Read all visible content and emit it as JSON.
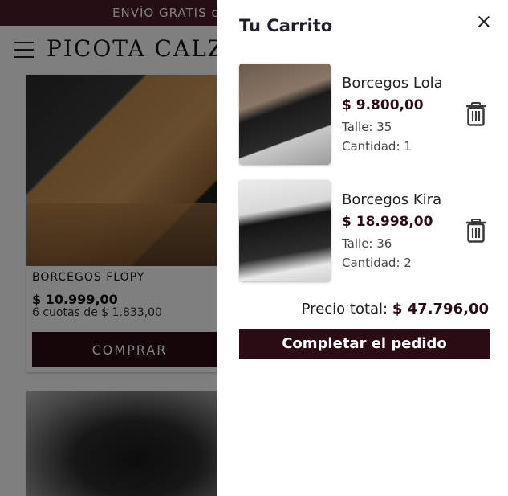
{
  "promo": {
    "text": "ENVÍO GRATIS c"
  },
  "header": {
    "logo": "PICOTA CALZ"
  },
  "product": {
    "name": "BORCEGOS FLOPY",
    "price": "$ 10.999,00",
    "installments": "6 cuotas de $ 1.833,00",
    "buy_label": "COMPRAR"
  },
  "cart": {
    "title": "Tu Carrito",
    "items": [
      {
        "name": "Borcegos Lola",
        "price": "$ 9.800,00",
        "size": "Talle: 35",
        "qty": "Cantidad: 1"
      },
      {
        "name": "Borcegos Kira",
        "price": "$ 18.998,00",
        "size": "Talle: 36",
        "qty": "Cantidad: 2"
      }
    ],
    "total_label": "Precio total:",
    "total_value": "$ 47.796,00",
    "checkout_label": "Completar el pedido"
  },
  "colors": {
    "brand": "#2b0c15",
    "promo_bar": "#4a1f2b",
    "overlay": "rgba(0,0,0,0.5)"
  },
  "icons": {
    "menu": "hamburger-icon",
    "close": "close-icon",
    "remove": "trash-icon"
  }
}
